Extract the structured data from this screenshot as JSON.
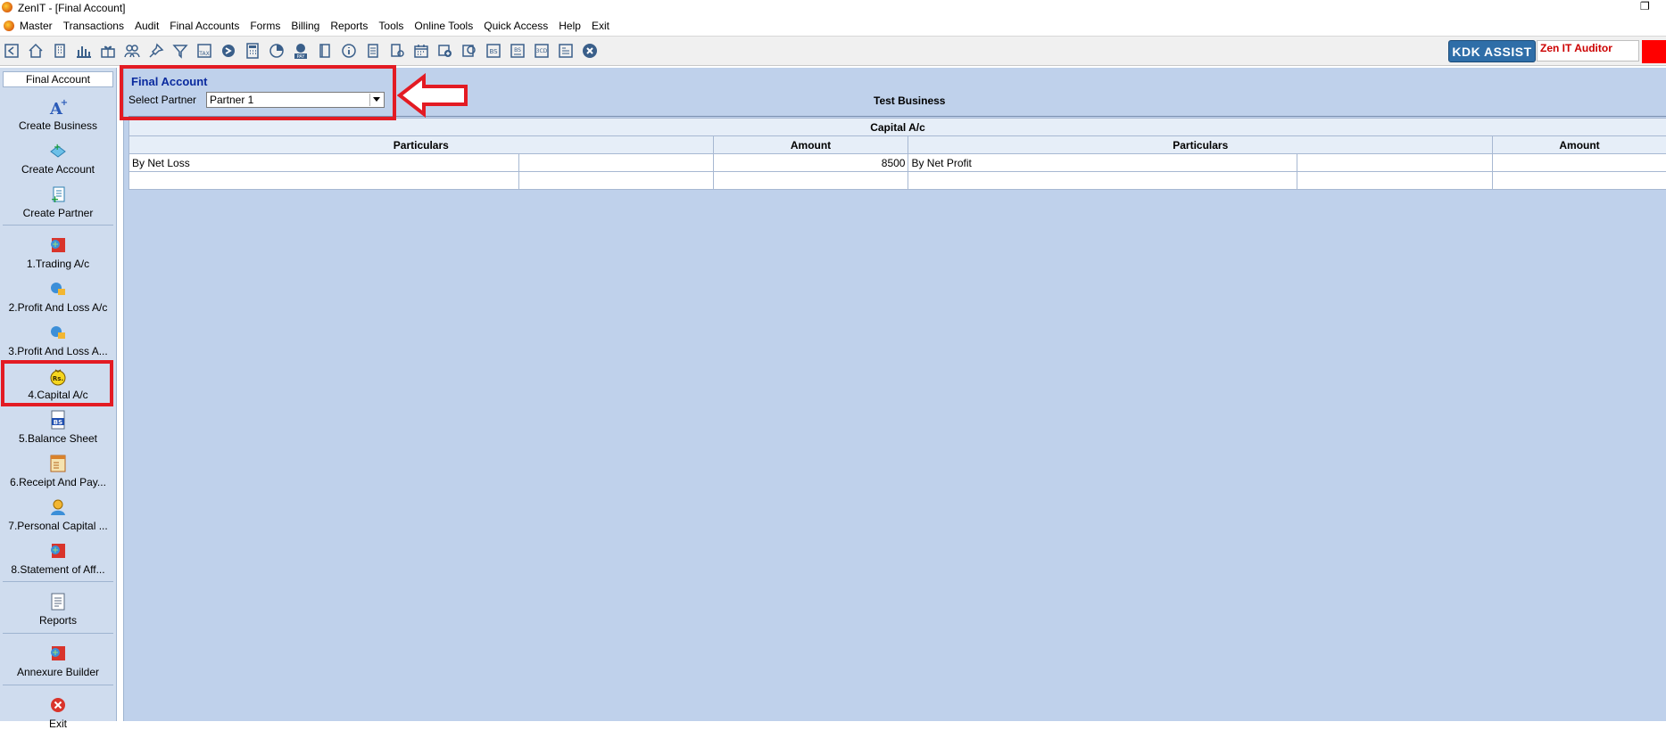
{
  "window": {
    "title": "ZenIT - [Final Account]"
  },
  "menu": [
    "Master",
    "Transactions",
    "Audit",
    "Final Accounts",
    "Forms",
    "Billing",
    "Reports",
    "Tools",
    "Online Tools",
    "Quick Access",
    "Help",
    "Exit"
  ],
  "toolbar": {
    "icons": [
      "home-icon",
      "building-icon",
      "bar-chart-icon",
      "gift-icon",
      "users-icon",
      "pin-icon",
      "filter-icon",
      "tax-icon",
      "arrow-circle-icon",
      "calculator-icon",
      "pie-icon",
      "pay-icon",
      "book-icon",
      "info-icon",
      "document-icon",
      "user-doc-icon",
      "calendar-icon",
      "add-circle-icon",
      "refresh-doc-icon",
      "bs-icon",
      "bs-doc-icon",
      "3cd-icon",
      "form-icon",
      "close-circle-icon"
    ],
    "kdk_label": "KDK ASSIST",
    "auditor_label": "Zen IT Auditor",
    "alert_color": "#ff0000"
  },
  "sidebar": {
    "header": "Final Account",
    "items": [
      {
        "label": "Create Business",
        "icon": "create-business-icon"
      },
      {
        "label": "Create Account",
        "icon": "create-account-icon"
      },
      {
        "label": "Create Partner",
        "icon": "create-partner-icon"
      },
      {
        "label": "1.Trading A/c",
        "icon": "trading-icon"
      },
      {
        "label": "2.Profit And Loss A/c",
        "icon": "profit-loss-icon"
      },
      {
        "label": "3.Profit And Loss A...",
        "icon": "profit-loss-icon"
      },
      {
        "label": "4.Capital A/c",
        "icon": "capital-icon"
      },
      {
        "label": "5.Balance Sheet",
        "icon": "balance-sheet-icon"
      },
      {
        "label": "6.Receipt And Pay...",
        "icon": "receipt-icon"
      },
      {
        "label": "7.Personal Capital ...",
        "icon": "personal-capital-icon"
      },
      {
        "label": "8.Statement of Aff...",
        "icon": "statement-icon"
      },
      {
        "label": "Reports",
        "icon": "reports-icon"
      },
      {
        "label": "Annexure Builder",
        "icon": "annexure-icon"
      },
      {
        "label": "Exit",
        "icon": "exit-icon"
      }
    ]
  },
  "main": {
    "section_title": "Final Account",
    "partner_label": "Select Partner",
    "partner_value": "Partner 1",
    "business_name": "Test Business",
    "table": {
      "title": "Capital A/c",
      "headers": [
        "Particulars",
        "Amount",
        "Particulars",
        "Amount"
      ],
      "rows": [
        {
          "left_particular": "By Net Loss",
          "left_extra": "",
          "left_amount": "8500",
          "right_particular": "By Net Profit",
          "right_extra": "",
          "right_amount": ""
        },
        {
          "left_particular": "",
          "left_extra": "",
          "left_amount": "",
          "right_particular": "",
          "right_extra": "",
          "right_amount": ""
        }
      ]
    }
  },
  "annotations": {
    "highlight_color": "#e31b23"
  }
}
